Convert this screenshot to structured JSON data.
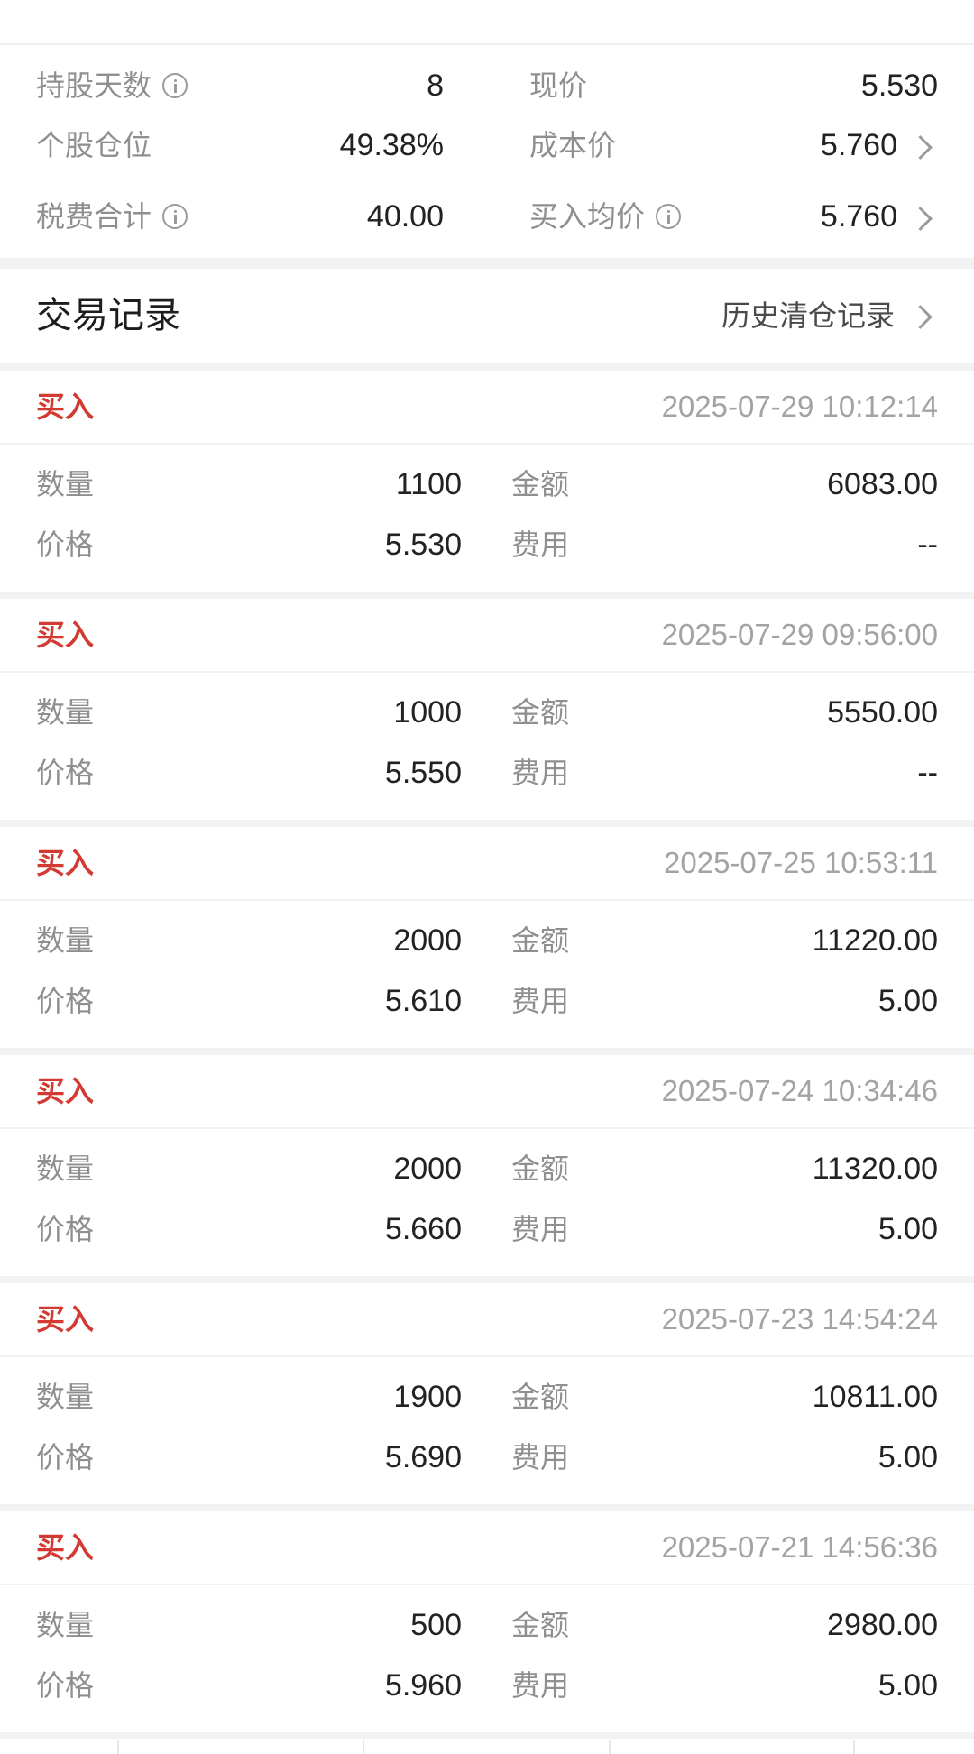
{
  "summary": {
    "hold_days": {
      "label": "持股天数",
      "value": "8"
    },
    "current_price": {
      "label": "现价",
      "value": "5.530"
    },
    "position_ratio": {
      "label": "个股仓位",
      "value": "49.38%"
    },
    "cost_price": {
      "label": "成本价",
      "value": "5.760"
    },
    "tax_fee_total": {
      "label": "税费合计",
      "value": "40.00"
    },
    "avg_buy_price": {
      "label": "买入均价",
      "value": "5.760"
    }
  },
  "records": {
    "title": "交易记录",
    "history_link": "历史清仓记录",
    "labels": {
      "quantity": "数量",
      "amount": "金额",
      "price": "价格",
      "fee": "费用"
    },
    "items": [
      {
        "type": "买入",
        "time": "2025-07-29 10:12:14",
        "quantity": "1100",
        "amount": "6083.00",
        "price": "5.530",
        "fee": "--"
      },
      {
        "type": "买入",
        "time": "2025-07-29 09:56:00",
        "quantity": "1000",
        "amount": "5550.00",
        "price": "5.550",
        "fee": "--"
      },
      {
        "type": "买入",
        "time": "2025-07-25 10:53:11",
        "quantity": "2000",
        "amount": "11220.00",
        "price": "5.610",
        "fee": "5.00"
      },
      {
        "type": "买入",
        "time": "2025-07-24 10:34:46",
        "quantity": "2000",
        "amount": "11320.00",
        "price": "5.660",
        "fee": "5.00"
      },
      {
        "type": "买入",
        "time": "2025-07-23 14:54:24",
        "quantity": "1900",
        "amount": "10811.00",
        "price": "5.690",
        "fee": "5.00"
      },
      {
        "type": "买入",
        "time": "2025-07-21 14:56:36",
        "quantity": "500",
        "amount": "2980.00",
        "price": "5.960",
        "fee": "5.00"
      }
    ]
  },
  "colors": {
    "buy": "#d23a32",
    "profit": "#25a83b",
    "muted": "#8f8f8f"
  }
}
